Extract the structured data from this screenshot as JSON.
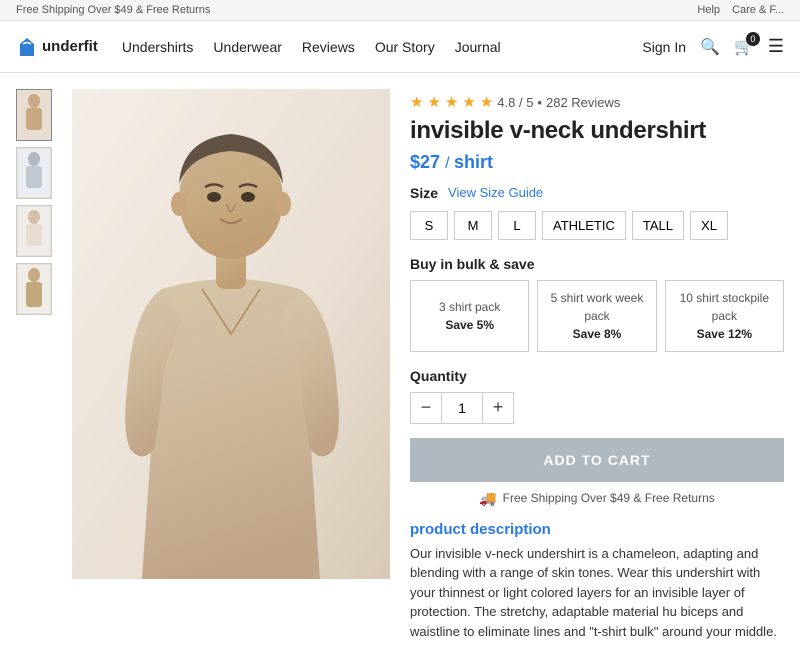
{
  "topbar": {
    "promo": "Free Shipping Over $49 & Free Returns",
    "links": [
      "Help",
      "Care & F..."
    ]
  },
  "nav": {
    "logo_text": "underfit",
    "links": [
      "Undershirts",
      "Underwear",
      "Reviews",
      "Our Story",
      "Journal"
    ],
    "sign_in": "Sign In",
    "cart_count": "0"
  },
  "product": {
    "rating": "4.8",
    "rating_max": "5",
    "reviews_count": "282 Reviews",
    "title": "invisible v-neck undershirt",
    "price": "$27",
    "price_unit": "shirt",
    "size_label": "Size",
    "size_guide_label": "View Size Guide",
    "sizes": [
      "S",
      "M",
      "L",
      "ATHLETIC",
      "TALL",
      "XL"
    ],
    "bulk_label": "Buy in bulk & save",
    "bulk_options": [
      {
        "pack": "3 shirt pack",
        "save": "Save 5%"
      },
      {
        "pack": "5 shirt work week pack",
        "save": "Save 8%"
      },
      {
        "pack": "10 shirt stockpile pack",
        "save": "Save 12%"
      }
    ],
    "quantity_label": "Quantity",
    "quantity": "1",
    "add_to_cart": "ADD TO CART",
    "shipping_note": "Free Shipping Over $49 & Free Returns",
    "description_heading_plain": "product ",
    "description_heading_blue": "description",
    "description_text": "Our invisible v-neck undershirt is a chameleon, adapting and blending with a range of skin tones. Wear this undershirt with your thinnest or light colored layers for an invisible layer of protection. The stretchy, adaptable material hu biceps and waistline to eliminate lines and \"t-shirt bulk\" around your middle."
  },
  "icons": {
    "search": "🔍",
    "cart": "🛒",
    "menu": "☰",
    "truck": "🚚",
    "minus": "−",
    "plus": "+"
  },
  "colors": {
    "accent": "#2a7ae2",
    "star": "#f5a623",
    "price": "#2a7ae2",
    "add_btn_bg": "#b0b8c0"
  }
}
